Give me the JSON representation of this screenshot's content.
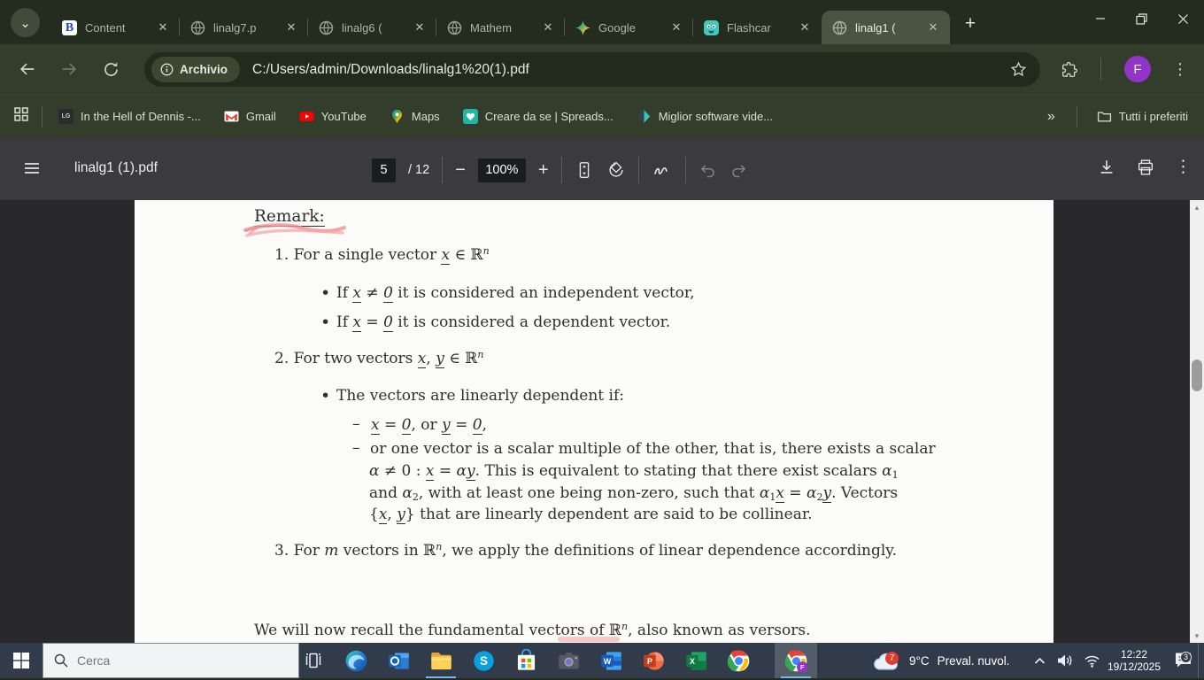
{
  "browser": {
    "tab_search_glyph": "⌄",
    "tabs": [
      {
        "label": "Content"
      },
      {
        "label": "linalg7.p"
      },
      {
        "label": "linalg6 ("
      },
      {
        "label": "Mathem"
      },
      {
        "label": "Google"
      },
      {
        "label": "Flashcar"
      },
      {
        "label": "linalg1 ("
      }
    ],
    "tab_close_glyph": "✕",
    "new_tab_glyph": "+",
    "address": {
      "chip_label": "Archivio",
      "url": "C:/Users/admin/Downloads/linalg1%20(1).pdf"
    },
    "profile_initial": "F",
    "menu_glyph": "⋮",
    "bookmarks": [
      {
        "label": "In the Hell of Dennis -..."
      },
      {
        "label": "Gmail"
      },
      {
        "label": "YouTube"
      },
      {
        "label": "Maps"
      },
      {
        "label": "Creare da se | Spreads..."
      },
      {
        "label": "Miglior software vide..."
      }
    ],
    "dennis_favicon_text": "LG",
    "bookmarks_overflow_glyph": "»",
    "all_bookmarks_label": "Tutti i preferiti"
  },
  "pdf": {
    "title": "linalg1 (1).pdf",
    "page_current": "5",
    "page_total": "/ 12",
    "zoom_out_glyph": "−",
    "zoom_level": "100%",
    "zoom_in_glyph": "+",
    "menu_glyph": "⋮",
    "scroll_up_glyph": "▲",
    "scroll_down_glyph": "▼"
  },
  "document": {
    "bullet": "•",
    "dash": "–",
    "remark": [
      [
        "p",
        "Remark:"
      ]
    ],
    "item1": [
      [
        "p",
        "1.  For a single vector "
      ],
      [
        "v",
        "x"
      ],
      [
        "p",
        " ∈ ℝ"
      ],
      [
        "s",
        "n"
      ]
    ],
    "item1_b1": [
      [
        "p",
        "If "
      ],
      [
        "v",
        "x"
      ],
      [
        "p",
        " ≠ "
      ],
      [
        "v",
        "0"
      ],
      [
        "p",
        " it is considered an independent vector,"
      ]
    ],
    "item1_b2": [
      [
        "p",
        "If "
      ],
      [
        "v",
        "x"
      ],
      [
        "p",
        " = "
      ],
      [
        "v",
        "0"
      ],
      [
        "p",
        " it is considered a dependent vector."
      ]
    ],
    "item2": [
      [
        "p",
        "2.  For two vectors "
      ],
      [
        "v",
        "x"
      ],
      [
        "p",
        ", "
      ],
      [
        "v",
        "y"
      ],
      [
        "p",
        " ∈ ℝ"
      ],
      [
        "s",
        "n"
      ]
    ],
    "item2_b1": [
      [
        "p",
        "The vectors are linearly dependent if:"
      ]
    ],
    "item2_d1": [
      [
        "v",
        "x"
      ],
      [
        "p",
        " = "
      ],
      [
        "v",
        "0"
      ],
      [
        "p",
        ", or "
      ],
      [
        "v",
        "y"
      ],
      [
        "p",
        " = "
      ],
      [
        "v",
        "0"
      ],
      [
        "p",
        ","
      ]
    ],
    "item2_d2_l1": [
      [
        "p",
        "or one vector is a scalar multiple of the other, that is, there exists a scalar"
      ]
    ],
    "item2_d2_l2": [
      [
        "i",
        "α"
      ],
      [
        "p",
        " ≠ 0 : "
      ],
      [
        "v",
        "x"
      ],
      [
        "p",
        " = "
      ],
      [
        "i",
        "α"
      ],
      [
        "v",
        "y"
      ],
      [
        "p",
        ".  This is equivalent to stating that there exist scalars "
      ],
      [
        "i",
        "α"
      ],
      [
        "b",
        "1"
      ]
    ],
    "item2_d2_l3": [
      [
        "p",
        "and "
      ],
      [
        "i",
        "α"
      ],
      [
        "b",
        "2"
      ],
      [
        "p",
        ", with at least one being non-zero, such that "
      ],
      [
        "i",
        "α"
      ],
      [
        "b",
        "1"
      ],
      [
        "v",
        "x"
      ],
      [
        "p",
        " = "
      ],
      [
        "i",
        "α"
      ],
      [
        "b",
        "2"
      ],
      [
        "v",
        "y"
      ],
      [
        "p",
        ".  Vectors"
      ]
    ],
    "item2_d2_l4": [
      [
        "p",
        "{"
      ],
      [
        "v",
        "x"
      ],
      [
        "p",
        ", "
      ],
      [
        "v",
        "y"
      ],
      [
        "p",
        "} that are linearly dependent are said to be collinear."
      ]
    ],
    "item3": [
      [
        "p",
        "3.  For "
      ],
      [
        "i",
        "m"
      ],
      [
        "p",
        " vectors in ℝ"
      ],
      [
        "s",
        "n"
      ],
      [
        "p",
        ", we apply the definitions of linear dependence accordingly."
      ]
    ],
    "footer": [
      [
        "p",
        "We will now recall the fundamental vectors of ℝ"
      ],
      [
        "s",
        "n"
      ],
      [
        "p",
        ", also known as versors."
      ]
    ]
  },
  "taskbar": {
    "search_placeholder": "Cerca",
    "weather": {
      "badge": "7",
      "temp": "9°C",
      "desc": "Preval. nuvol."
    },
    "clock": {
      "time": "12:22",
      "date": "19/12/2025"
    },
    "notifications_badge": "3"
  }
}
